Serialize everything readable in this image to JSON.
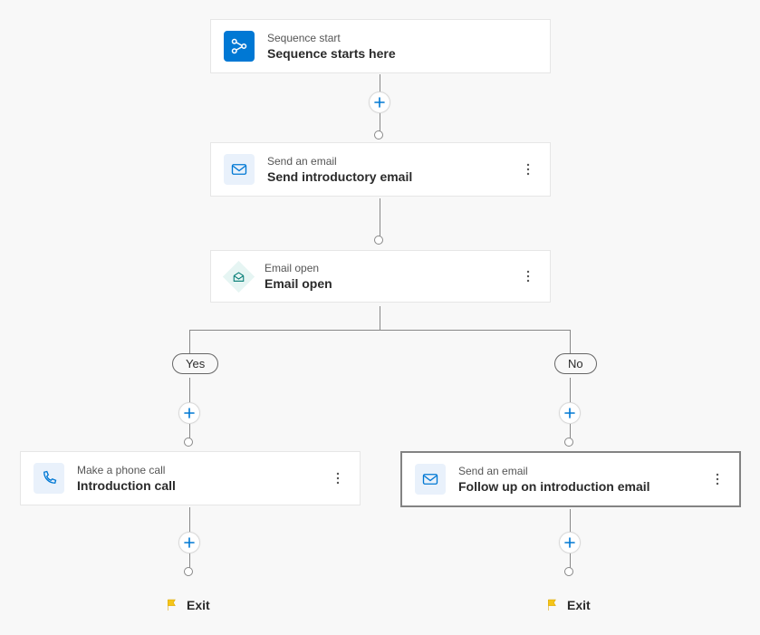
{
  "nodes": {
    "start": {
      "type": "Sequence start",
      "title": "Sequence starts here"
    },
    "step1": {
      "type": "Send an email",
      "title": "Send introductory email"
    },
    "cond": {
      "type": "Email open",
      "title": "Email open"
    },
    "branchYes": {
      "label": "Yes",
      "step": {
        "type": "Make a phone call",
        "title": "Introduction call"
      },
      "exit": "Exit"
    },
    "branchNo": {
      "label": "No",
      "step": {
        "type": "Send an email",
        "title": "Follow up on introduction email"
      },
      "exit": "Exit"
    }
  }
}
